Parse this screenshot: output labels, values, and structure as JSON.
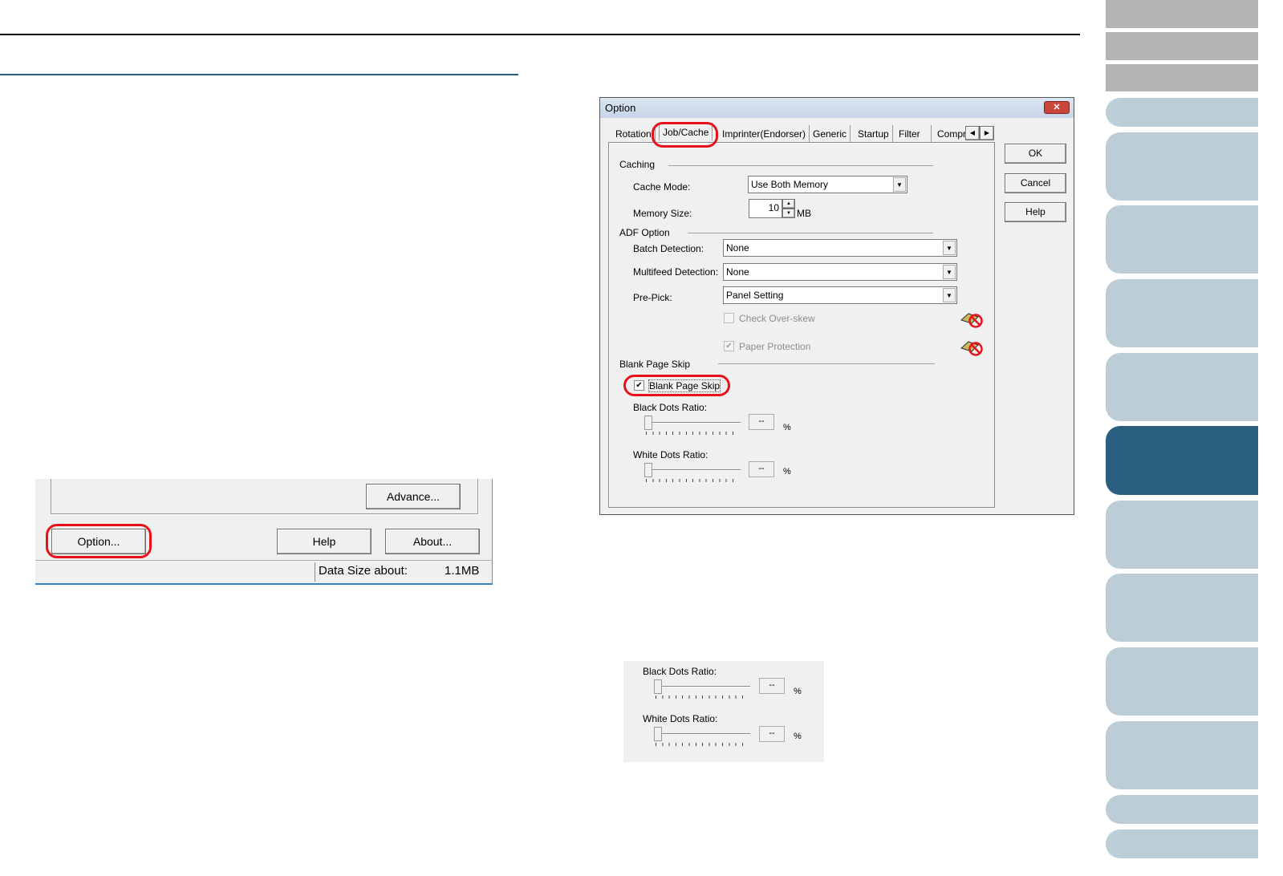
{
  "left_screenshot": {
    "advance_button": "Advance...",
    "option_button": "Option...",
    "help_button": "Help",
    "about_button": "About...",
    "status_label": "Data Size about:",
    "status_value": "1.1MB"
  },
  "dialog": {
    "title": "Option",
    "close_icon": "close-icon",
    "tabs": [
      "Rotation",
      "Job/Cache",
      "Imprinter(Endorser)",
      "Generic",
      "Startup",
      "Filter",
      "Compr"
    ],
    "active_tab": "Job/Cache",
    "buttons": {
      "ok": "OK",
      "cancel": "Cancel",
      "help": "Help"
    },
    "caching": {
      "group": "Caching",
      "cache_mode_label": "Cache Mode:",
      "cache_mode_value": "Use Both Memory",
      "memory_size_label": "Memory Size:",
      "memory_size_value": "10",
      "memory_unit": "MB"
    },
    "adf": {
      "group": "ADF Option",
      "batch_label": "Batch Detection:",
      "batch_value": "None",
      "multifeed_label": "Multifeed Detection:",
      "multifeed_value": "None",
      "prepick_label": "Pre-Pick:",
      "prepick_value": "Panel Setting",
      "check_overskew": "Check Over-skew",
      "check_overskew_checked": false,
      "paper_protection": "Paper Protection",
      "paper_protection_checked": true
    },
    "blank": {
      "group": "Blank Page Skip",
      "checkbox": "Blank Page Skip",
      "checked": true,
      "black_label": "Black Dots Ratio:",
      "black_value": "--",
      "white_label": "White Dots Ratio:",
      "white_value": "--",
      "unit": "%"
    }
  },
  "detail": {
    "black_label": "Black Dots Ratio:",
    "black_value": "--",
    "white_label": "White Dots Ratio:",
    "white_value": "--",
    "unit": "%"
  },
  "colors": {
    "accent": "#2a5f7f",
    "highlight": "#e8101a",
    "tab": "#bdcdd7"
  }
}
